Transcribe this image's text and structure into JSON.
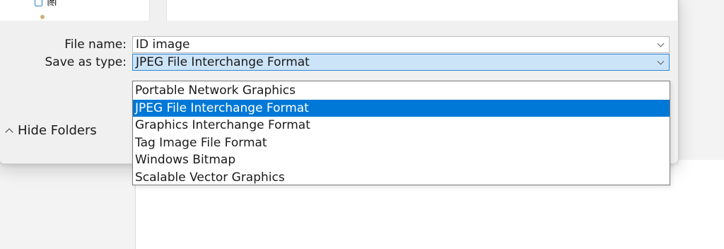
{
  "dialog": {
    "nav_pane": {
      "partial_item_label": "图片"
    },
    "file_name": {
      "label": "File name:",
      "value": "ID image"
    },
    "save_as_type": {
      "label": "Save as type:",
      "value": "JPEG File Interchange Format",
      "options": [
        "Portable Network Graphics",
        "JPEG File Interchange Format",
        "Graphics Interchange Format",
        "Tag Image File Format",
        "Windows Bitmap",
        "Scalable Vector Graphics"
      ],
      "selected_index": 1
    },
    "hide_folders": {
      "label": "Hide Folders"
    }
  },
  "colors": {
    "selection_highlight": "#0078d7",
    "focused_field": "#cce4f7",
    "focus_border": "#2f86d6"
  },
  "icons": {
    "nav_folder": "folder-icon",
    "field_dropdown": "chevron-down-icon",
    "hide_folders": "chevron-up-icon"
  }
}
